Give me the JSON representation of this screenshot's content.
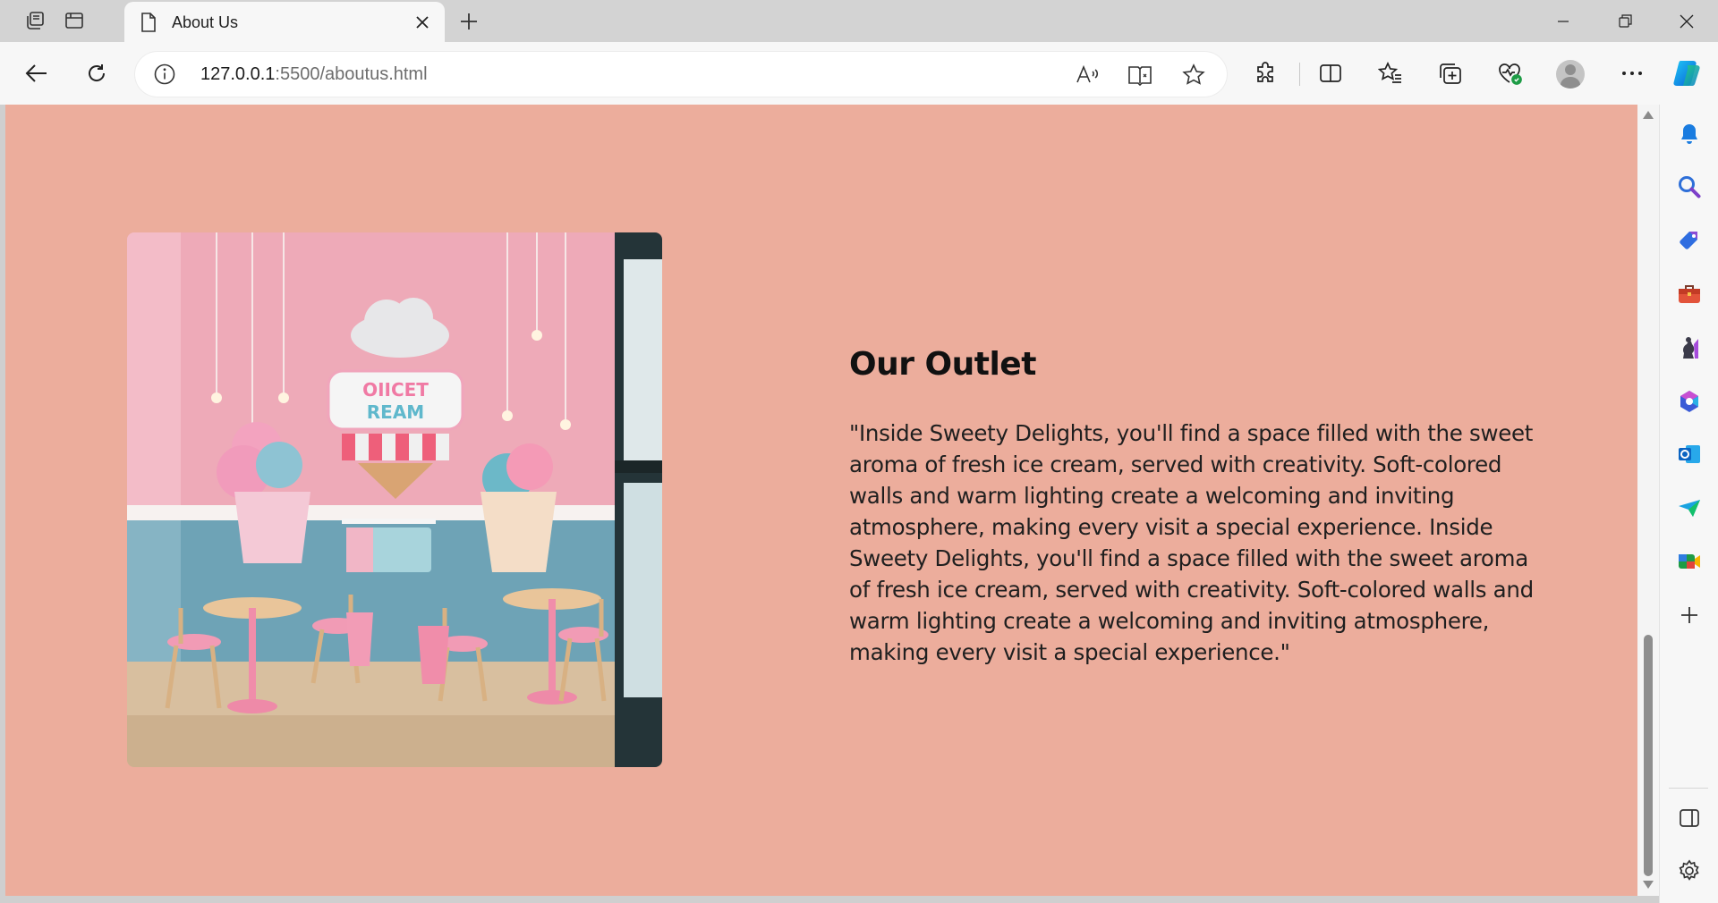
{
  "browser": {
    "tab": {
      "title": "About Us"
    },
    "address_bar": {
      "host": "127.0.0.1",
      "path": ":5500/aboutus.html"
    },
    "colors": {
      "accent": "#0078d4",
      "page_background": "#ecad9c"
    }
  },
  "page": {
    "outlet": {
      "title": "Our Outlet",
      "description": "\"Inside Sweety Delights, you'll find a space filled with the sweet aroma of fresh ice cream, served with creativity. Soft-colored walls and warm lighting create a welcoming and inviting atmosphere, making every visit a special experience. Inside Sweety Delights, you'll find a space filled with the sweet aroma of fresh ice cream, served with creativity. Soft-colored walls and warm lighting create a welcoming and inviting atmosphere, making every visit a special experience.\"",
      "sign_text": [
        "OIICET",
        "REAM"
      ]
    }
  }
}
